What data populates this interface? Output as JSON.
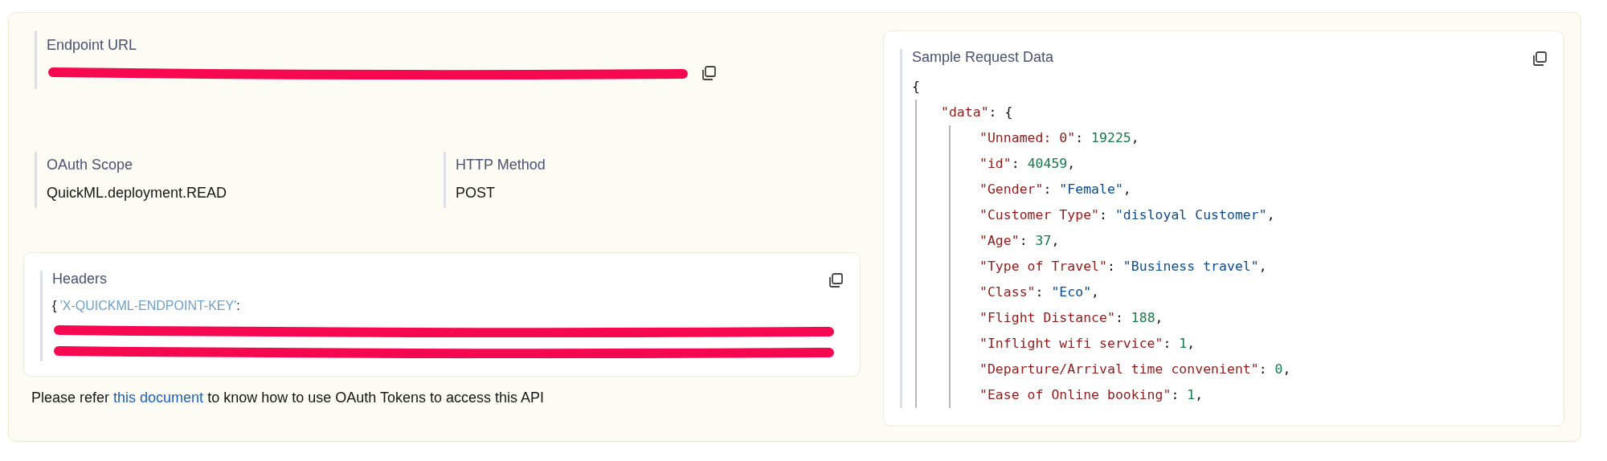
{
  "endpoint": {
    "label": "Endpoint URL",
    "redacted": true
  },
  "oauth_scope": {
    "label": "OAuth Scope",
    "value": "QuickML.deployment.READ"
  },
  "http_method": {
    "label": "HTTP Method",
    "value": "POST"
  },
  "headers": {
    "title": "Headers",
    "tokens": [
      {
        "text": "{ ",
        "kind": "punct"
      },
      {
        "text": "'X-QUICKML-ENDPOINT-KEY'",
        "kind": "hkey"
      },
      {
        "text": ":",
        "kind": "punct"
      }
    ],
    "lines": [
      {
        "redacted": true
      },
      {
        "redacted": true
      }
    ]
  },
  "note": {
    "before": "Please refer ",
    "link": "this document",
    "after": " to know how to use OAuth Tokens to access this API"
  },
  "sample_request": {
    "title": "Sample Request Data",
    "code": {
      "tokens": [
        {
          "text": "{",
          "kind": "punct"
        }
      ],
      "children": [
        {
          "tokens": [
            {
              "text": "\"data\"",
              "kind": "key"
            },
            {
              "text": ": {",
              "kind": "punct"
            }
          ],
          "children": [
            {
              "tokens": [
                {
                  "text": "\"Unnamed: 0\"",
                  "kind": "key"
                },
                {
                  "text": ": ",
                  "kind": "punct"
                },
                {
                  "text": "19225",
                  "kind": "number"
                },
                {
                  "text": ",",
                  "kind": "punct"
                }
              ]
            },
            {
              "tokens": [
                {
                  "text": "\"id\"",
                  "kind": "key"
                },
                {
                  "text": ": ",
                  "kind": "punct"
                },
                {
                  "text": "40459",
                  "kind": "number"
                },
                {
                  "text": ",",
                  "kind": "punct"
                }
              ]
            },
            {
              "tokens": [
                {
                  "text": "\"Gender\"",
                  "kind": "key"
                },
                {
                  "text": ": ",
                  "kind": "punct"
                },
                {
                  "text": "\"Female\"",
                  "kind": "string"
                },
                {
                  "text": ",",
                  "kind": "punct"
                }
              ]
            },
            {
              "tokens": [
                {
                  "text": "\"Customer Type\"",
                  "kind": "key"
                },
                {
                  "text": ": ",
                  "kind": "punct"
                },
                {
                  "text": "\"disloyal Customer\"",
                  "kind": "string"
                },
                {
                  "text": ",",
                  "kind": "punct"
                }
              ]
            },
            {
              "tokens": [
                {
                  "text": "\"Age\"",
                  "kind": "key"
                },
                {
                  "text": ": ",
                  "kind": "punct"
                },
                {
                  "text": "37",
                  "kind": "number"
                },
                {
                  "text": ",",
                  "kind": "punct"
                }
              ]
            },
            {
              "tokens": [
                {
                  "text": "\"Type of Travel\"",
                  "kind": "key"
                },
                {
                  "text": ": ",
                  "kind": "punct"
                },
                {
                  "text": "\"Business travel\"",
                  "kind": "string"
                },
                {
                  "text": ",",
                  "kind": "punct"
                }
              ]
            },
            {
              "tokens": [
                {
                  "text": "\"Class\"",
                  "kind": "key"
                },
                {
                  "text": ": ",
                  "kind": "punct"
                },
                {
                  "text": "\"Eco\"",
                  "kind": "string"
                },
                {
                  "text": ",",
                  "kind": "punct"
                }
              ]
            },
            {
              "tokens": [
                {
                  "text": "\"Flight Distance\"",
                  "kind": "key"
                },
                {
                  "text": ": ",
                  "kind": "punct"
                },
                {
                  "text": "188",
                  "kind": "number"
                },
                {
                  "text": ",",
                  "kind": "punct"
                }
              ]
            },
            {
              "tokens": [
                {
                  "text": "\"Inflight wifi service\"",
                  "kind": "key"
                },
                {
                  "text": ": ",
                  "kind": "punct"
                },
                {
                  "text": "1",
                  "kind": "number"
                },
                {
                  "text": ",",
                  "kind": "punct"
                }
              ]
            },
            {
              "tokens": [
                {
                  "text": "\"Departure/Arrival time convenient\"",
                  "kind": "key"
                },
                {
                  "text": ": ",
                  "kind": "punct"
                },
                {
                  "text": "0",
                  "kind": "number"
                },
                {
                  "text": ",",
                  "kind": "punct"
                }
              ]
            },
            {
              "tokens": [
                {
                  "text": "\"Ease of Online booking\"",
                  "kind": "key"
                },
                {
                  "text": ": ",
                  "kind": "punct"
                },
                {
                  "text": "1",
                  "kind": "number"
                },
                {
                  "text": ",",
                  "kind": "punct"
                }
              ]
            }
          ]
        }
      ]
    }
  }
}
